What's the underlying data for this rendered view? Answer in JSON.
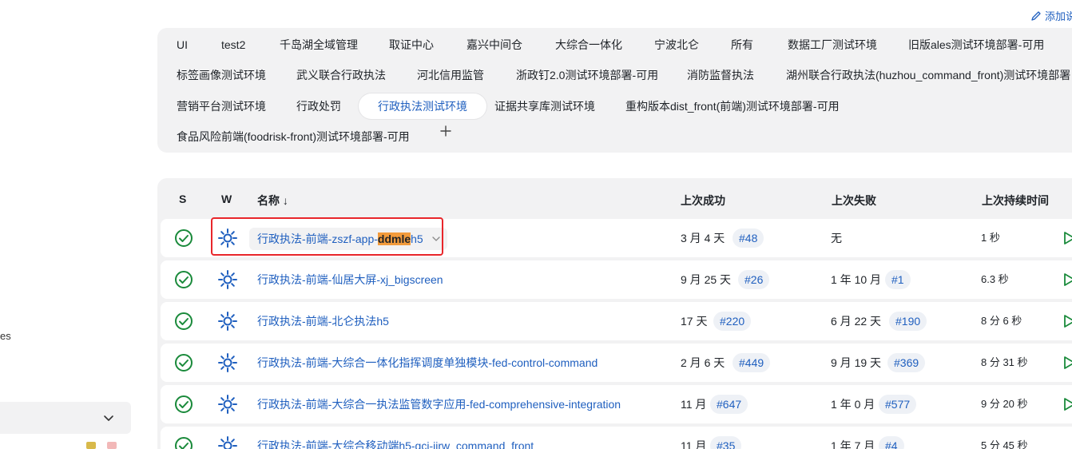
{
  "sidebar": {
    "fragment_text": "es",
    "dropdown_icon": "chevron-down-icon"
  },
  "header": {
    "add_description_label": "添加说"
  },
  "tabs": [
    {
      "label": "UI"
    },
    {
      "label": "test2"
    },
    {
      "label": "千岛湖全域管理"
    },
    {
      "label": "取证中心"
    },
    {
      "label": "嘉兴中间仓"
    },
    {
      "label": "大综合一体化"
    },
    {
      "label": "宁波北仑"
    },
    {
      "label": "所有"
    },
    {
      "label": "数据工厂测试环境"
    },
    {
      "label": "旧版ales测试环境部署-可用"
    },
    {
      "label": "标签画像测试环境"
    },
    {
      "label": "武义联合行政执法"
    },
    {
      "label": "河北信用监管"
    },
    {
      "label": "浙政钉2.0测试环境部署-可用"
    },
    {
      "label": "消防监督执法"
    },
    {
      "label": "湖州联合行政执法(huzhou_command_front)测试环境部署"
    },
    {
      "label": "营销平台测试环境"
    },
    {
      "label": "行政处罚"
    },
    {
      "label": "行政执法测试环境",
      "active": true
    },
    {
      "label": "证据共享库测试环境"
    },
    {
      "label": "重构版本dist_front(前端)测试环境部署-可用"
    },
    {
      "label": "食品风险前端(foodrisk-front)测试环境部署-可用"
    }
  ],
  "table": {
    "headers": {
      "s": "S",
      "w": "W",
      "name": "名称 ↓",
      "last_success": "上次成功",
      "last_failure": "上次失败",
      "last_duration": "上次持续时间"
    },
    "rows": [
      {
        "name_prefix": "行政执法-前端-zszf-app-",
        "name_highlight": "ddmle",
        "name_suffix": "h5",
        "success_time": "3 月 4 天",
        "success_build": "#48",
        "failure_time": "无",
        "failure_build": "",
        "duration": "1 秒"
      },
      {
        "name": "行政执法-前端-仙居大屏-xj_bigscreen",
        "success_time": "9 月 25 天",
        "success_build": "#26",
        "failure_time": "1 年 10 月",
        "failure_build": "#1",
        "duration": "6.3 秒"
      },
      {
        "name": "行政执法-前端-北仑执法h5",
        "success_time": "17 天",
        "success_build": "#220",
        "failure_time": "6 月 22 天",
        "failure_build": "#190",
        "duration": "8 分 6 秒"
      },
      {
        "name": "行政执法-前端-大综合一体化指挥调度单独模块-fed-control-command",
        "success_time": "2 月 6 天",
        "success_build": "#449",
        "failure_time": "9 月 19 天",
        "failure_build": "#369",
        "duration": "8 分 31 秒"
      },
      {
        "name": "行政执法-前端-大综合一执法监管数字应用-fed-comprehensive-integration",
        "success_time": "11 月",
        "success_build": "#647",
        "failure_time": "1 年 0 月",
        "failure_build": "#577",
        "duration": "9 分 20 秒"
      },
      {
        "name": "行政执法-前端-大综合移动端h5-gcj-jirw_command_front",
        "success_time": "11 月",
        "success_build": "#35",
        "failure_time": "1 年 7 月",
        "failure_build": "#4",
        "duration": "5 分 45 秒"
      }
    ]
  },
  "colors": {
    "link": "#1f5fbf",
    "success": "#1a8a3b",
    "panel": "#f2f2f3",
    "highlight_box": "#e8262b",
    "search_highlight": "#f29b3c"
  }
}
